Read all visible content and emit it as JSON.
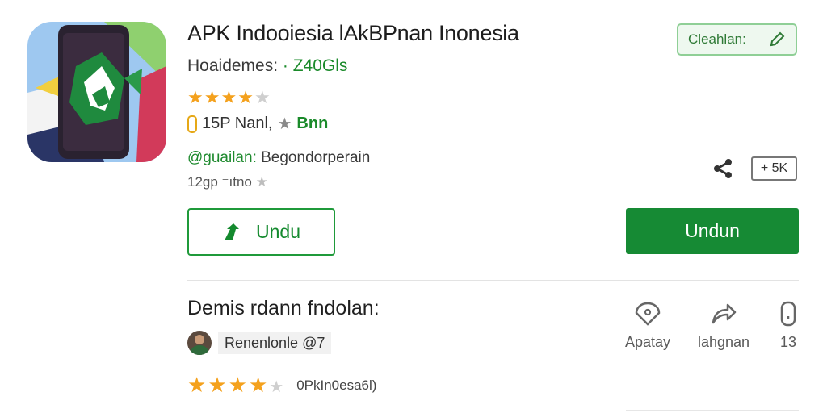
{
  "app": {
    "title": "APK Indooiesia lAkBPnan Inonesia",
    "subtitle": "Hoaidemes:",
    "subtitle_extra": "· Z40Gls",
    "rating_stars": 4,
    "meta_text": "15P Nanl,",
    "meta_green": "Bnn",
    "developer_handle": "@guailan:",
    "developer_rest": "Begondorperain",
    "small_rating_text": "12gp ⁻ıtno",
    "share_count": "+ 5K"
  },
  "chip": {
    "label": "Cleahlan:"
  },
  "buttons": {
    "outline_label": "Undu",
    "primary_label": "Undun"
  },
  "reviews": {
    "section_title": "Demis  rdann fndolan:",
    "reviewer_name": "Renenlonle @7",
    "stars": 4,
    "review_text": "0PkIn0esa6l)"
  },
  "actions": [
    {
      "label": "Apatay",
      "icon": "tag-icon"
    },
    {
      "label": "lahgnan",
      "icon": "share-arrow-icon"
    },
    {
      "label": "13",
      "icon": "phone-icon"
    }
  ],
  "colors": {
    "accent": "#168a34",
    "star": "#f4a11d"
  }
}
